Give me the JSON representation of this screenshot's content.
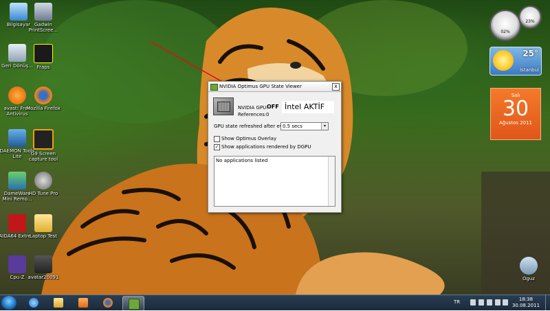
{
  "desktop": {
    "icons_left": [
      {
        "label": "Bilgisayar",
        "icon": "computer-icon"
      },
      {
        "label": "Gadwin PrintScree...",
        "icon": "printscreen-icon"
      },
      {
        "label": "Geri Dönüş...",
        "icon": "recycle-bin-icon"
      },
      {
        "label": "Fraps",
        "icon": "fraps-icon"
      },
      {
        "label": "avast! Free Antivirus",
        "icon": "avast-icon"
      },
      {
        "label": "Mozilla Firefox",
        "icon": "firefox-icon"
      },
      {
        "label": "DAEMON Tools Lite",
        "icon": "daemon-tools-icon"
      },
      {
        "label": "G9 Screen capture tool",
        "icon": "g9-icon"
      },
      {
        "label": "DameWare Mini Remo...",
        "icon": "dameware-icon"
      },
      {
        "label": "HD Tune Pro",
        "icon": "hd-tune-icon"
      },
      {
        "label": "AIDA64 Extre...",
        "icon": "aida64-icon"
      },
      {
        "label": "Laptop Test",
        "icon": "folder-icon"
      },
      {
        "label": "Cpu-Z",
        "icon": "cpuz-icon"
      },
      {
        "label": "avatar20091",
        "icon": "game-icon"
      }
    ],
    "icon_right": {
      "label": "Oguz",
      "icon": "user-folder-icon"
    }
  },
  "gadgets": {
    "cpu": {
      "cpu_value": "02%",
      "ram_value": "23%"
    },
    "weather": {
      "temperature": "25°",
      "city": "İstanbul"
    },
    "calendar": {
      "weekday": "Salı",
      "day": "30",
      "month_year": "Ağustos 2011"
    }
  },
  "window": {
    "title": "NVIDIA Optimus GPU State Viewer",
    "close_label": "x",
    "gpu_label": "NVIDIA GPU:",
    "gpu_state": "OFF",
    "annotation": "İntel AKTİF",
    "references_label": "References:",
    "references_value": "0",
    "refresh_label": "GPU state refreshed after every:",
    "refresh_value": "0.5 secs",
    "refresh_dropdown_glyph": "▾",
    "overlay_label": "Show Optimus Overlay",
    "overlay_checked": false,
    "dgpu_label": "Show applications rendered by DGPU",
    "dgpu_checked": true,
    "check_glyph": "✓",
    "app_list_empty": "No applications listed"
  },
  "taskbar": {
    "pinned": [
      "internet-explorer-icon",
      "explorer-icon",
      "media-player-icon",
      "firefox-icon",
      "nvidia-icon"
    ],
    "active_index": 4,
    "language": "TR",
    "time": "18:38",
    "date": "30.08.2011"
  },
  "colors": {
    "annotation_arrow": "#e01010",
    "taskbar": "#1f3246",
    "calendar": "#ef6620"
  }
}
